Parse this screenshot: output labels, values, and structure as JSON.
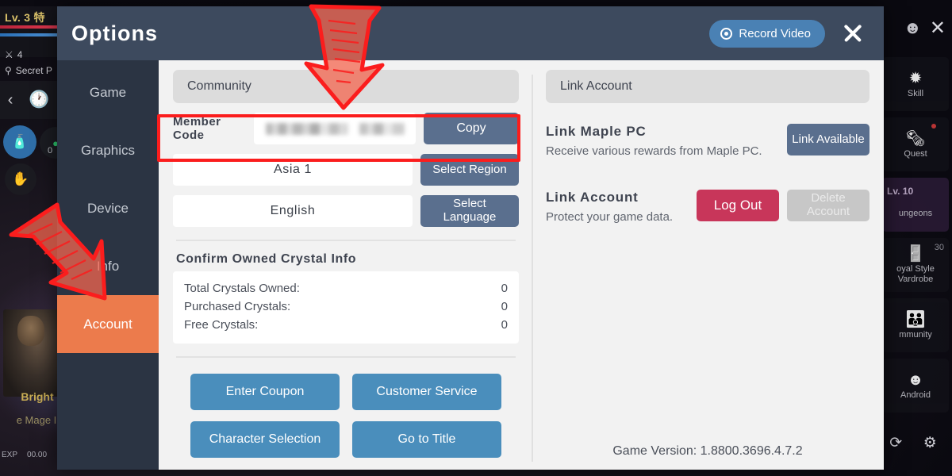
{
  "game_hud": {
    "level_text": "Lv. 3 特",
    "stat_count": "4",
    "location": "Secret P",
    "resource_count": "0",
    "character_name": "Bright",
    "character_class": "e Mage I",
    "exp_label": "EXP",
    "exp_value": "00.00",
    "right_menu": [
      {
        "label": "Skill",
        "icon": "skill-icon",
        "glyph": "✹",
        "badge": ""
      },
      {
        "label": "Quest",
        "icon": "quest-icon",
        "glyph": "🗞",
        "badge": ""
      },
      {
        "label": "ungeons",
        "icon": "dungeon-icon",
        "glyph": "⛨",
        "badge": "Lv. 10"
      },
      {
        "label": "oyal Style\nVardrobe",
        "icon": "wardrobe-icon",
        "glyph": "🚪",
        "badge": "30"
      },
      {
        "label": "mmunity",
        "icon": "community-icon",
        "glyph": "👪",
        "badge": ""
      },
      {
        "label": "Android",
        "icon": "android-icon",
        "glyph": "🤖",
        "badge": ""
      }
    ],
    "bottom_icons": [
      "rotate-icon",
      "gear-icon"
    ]
  },
  "dialog": {
    "title": "Options",
    "record_label": "Record Video",
    "close_label": "×",
    "nav_items": [
      {
        "label": "Game",
        "active": false
      },
      {
        "label": "Graphics",
        "active": false
      },
      {
        "label": "Device",
        "active": false
      },
      {
        "label": "Info",
        "active": false
      },
      {
        "label": "Account",
        "active": true
      }
    ],
    "community": {
      "heading": "Community",
      "member_code_label": "Member\nCode",
      "member_code_value": "",
      "copy_label": "Copy",
      "region_value": "Asia 1",
      "select_region_label": "Select Region",
      "language_value": "English",
      "select_language_label": "Select\nLanguage",
      "crystal_title": "Confirm Owned Crystal Info",
      "crystals": [
        {
          "label": "Total Crystals Owned:",
          "value": "0"
        },
        {
          "label": "Purchased Crystals:",
          "value": "0"
        },
        {
          "label": "Free Crystals:",
          "value": "0"
        }
      ],
      "actions": [
        "Enter Coupon",
        "Customer Service",
        "Character Selection",
        "Go to Title"
      ]
    },
    "link_account": {
      "heading": "Link Account",
      "maple_pc_title": "Link Maple PC",
      "maple_pc_sub": "Receive various rewards from Maple PC.",
      "maple_pc_button": "Link Available",
      "account_title": "Link Account",
      "account_sub": "Protect your game data.",
      "logout_button": "Log Out",
      "delete_button": "Delete\nAccount",
      "game_version": "Game Version: 1.8800.3696.4.7.2"
    }
  },
  "annotations": {
    "highlight_box_target": "member-code-row",
    "arrow_down_target": "community-section",
    "arrow_diagonal_target": "account-nav-item",
    "color": "#fb1d1d"
  }
}
